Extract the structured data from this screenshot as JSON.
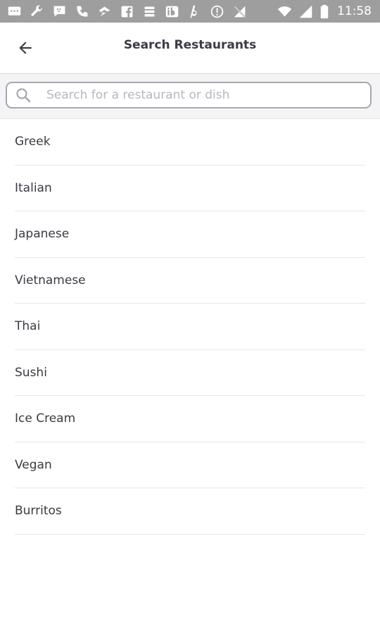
{
  "status_bar": {
    "time": "11:58",
    "left_icons": [
      "chat-icon",
      "wrench-icon",
      "blackberry-messenger-icon",
      "phone-icon",
      "zillow-icon",
      "facebook-icon",
      "stack-icon",
      "ibotta-icon",
      "italic-b-icon",
      "vpn-icon",
      "no-signal-icon"
    ],
    "right_icons": [
      "wifi-icon",
      "cellular-signal-icon",
      "battery-icon"
    ],
    "background": "#9e9e9e"
  },
  "header": {
    "title": "Search Restaurants",
    "back_icon": "arrow-back-icon"
  },
  "search": {
    "placeholder": "Search for a restaurant or dish",
    "value": "",
    "icon": "search-icon"
  },
  "categories": [
    {
      "label": "Greek"
    },
    {
      "label": "Italian"
    },
    {
      "label": "Japanese"
    },
    {
      "label": "Vietnamese"
    },
    {
      "label": "Thai"
    },
    {
      "label": "Sushi"
    },
    {
      "label": "Ice Cream"
    },
    {
      "label": "Vegan"
    },
    {
      "label": "Burritos"
    }
  ],
  "colors": {
    "text": "#3a3a42",
    "placeholder": "#b7b7bd",
    "search_border": "#a7a7ad",
    "divider": "#e6e6e8"
  }
}
